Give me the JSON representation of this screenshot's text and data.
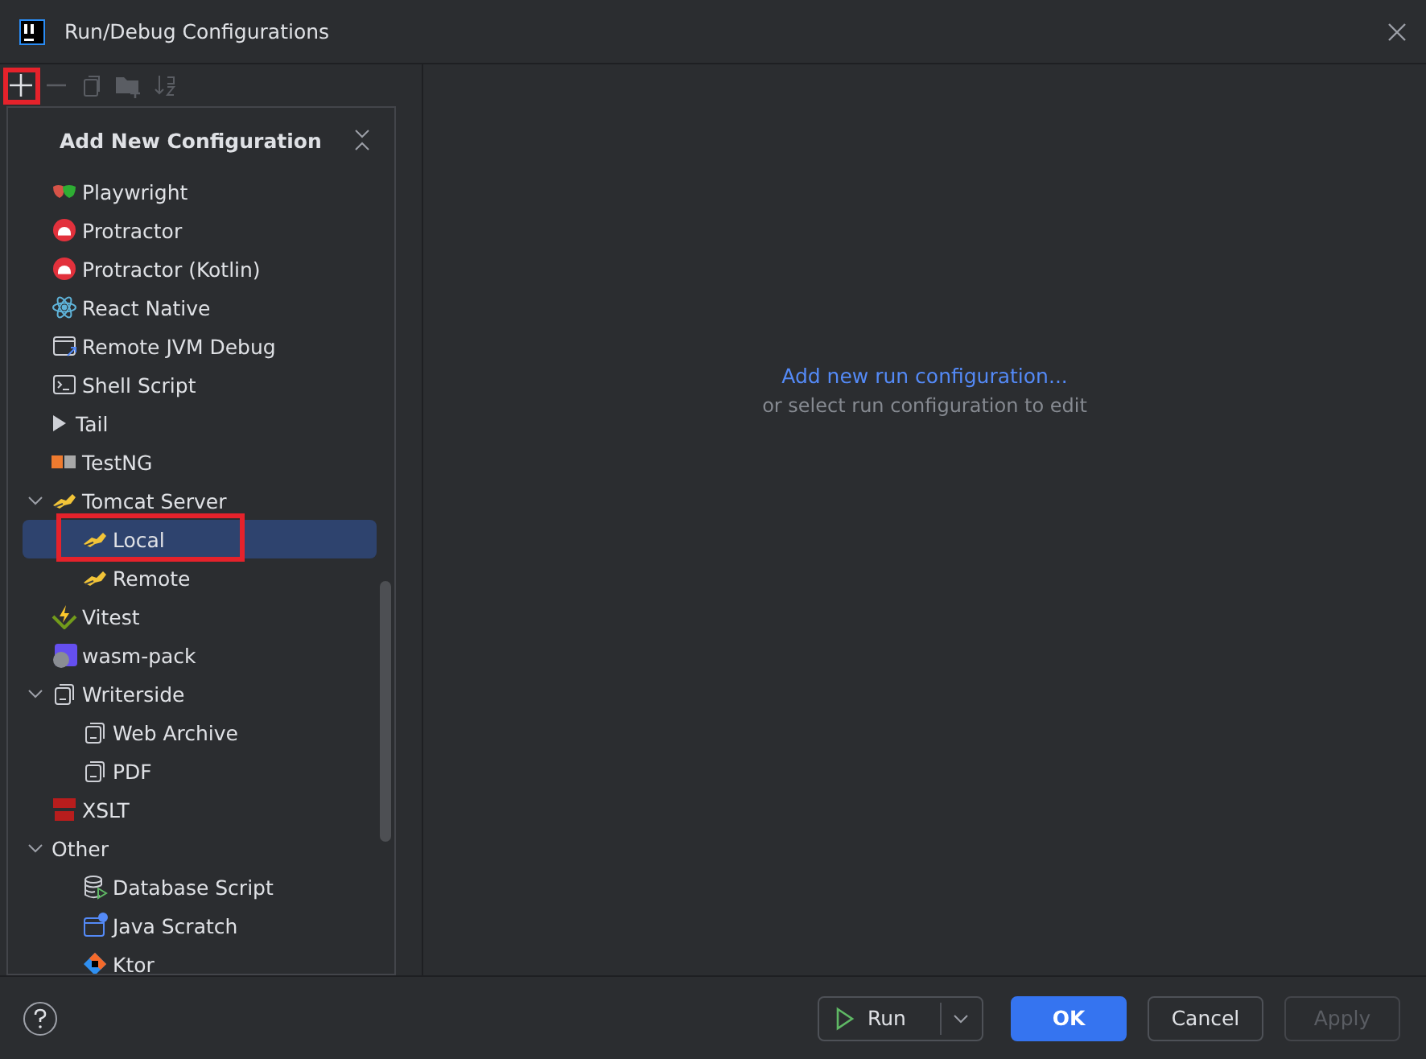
{
  "window": {
    "title": "Run/Debug Configurations"
  },
  "popup": {
    "title": "Add New Configuration",
    "items": [
      {
        "label": "Playwright",
        "selected": false
      },
      {
        "label": "Protractor",
        "selected": false
      },
      {
        "label": "Protractor (Kotlin)",
        "selected": false
      },
      {
        "label": "React Native",
        "selected": false
      },
      {
        "label": "Remote JVM Debug",
        "selected": false
      },
      {
        "label": "Shell Script",
        "selected": false
      },
      {
        "label": "Tail",
        "selected": false
      },
      {
        "label": "TestNG",
        "selected": false
      },
      {
        "label": "Tomcat Server",
        "selected": false,
        "expanded": true,
        "children": [
          {
            "label": "Local",
            "selected": true
          },
          {
            "label": "Remote",
            "selected": false
          }
        ]
      },
      {
        "label": "Vitest",
        "selected": false
      },
      {
        "label": "wasm-pack",
        "selected": false
      },
      {
        "label": "Writerside",
        "selected": false,
        "expanded": true,
        "children": [
          {
            "label": "Web Archive",
            "selected": false
          },
          {
            "label": "PDF",
            "selected": false
          }
        ]
      },
      {
        "label": "XSLT",
        "selected": false
      },
      {
        "label": "Other",
        "selected": false,
        "expanded": true,
        "children": [
          {
            "label": "Database Script",
            "selected": false
          },
          {
            "label": "Java Scratch",
            "selected": false
          },
          {
            "label": "Ktor",
            "selected": false
          }
        ]
      }
    ]
  },
  "content": {
    "link": "Add new run configuration...",
    "hint": "or select run configuration to edit"
  },
  "footer": {
    "buttons": [
      {
        "label": "Run",
        "kind": "split",
        "disabled": false
      },
      {
        "label": "OK",
        "kind": "primary",
        "disabled": false
      },
      {
        "label": "Cancel",
        "kind": "default",
        "disabled": false
      },
      {
        "label": "Apply",
        "kind": "default",
        "disabled": true
      }
    ]
  }
}
